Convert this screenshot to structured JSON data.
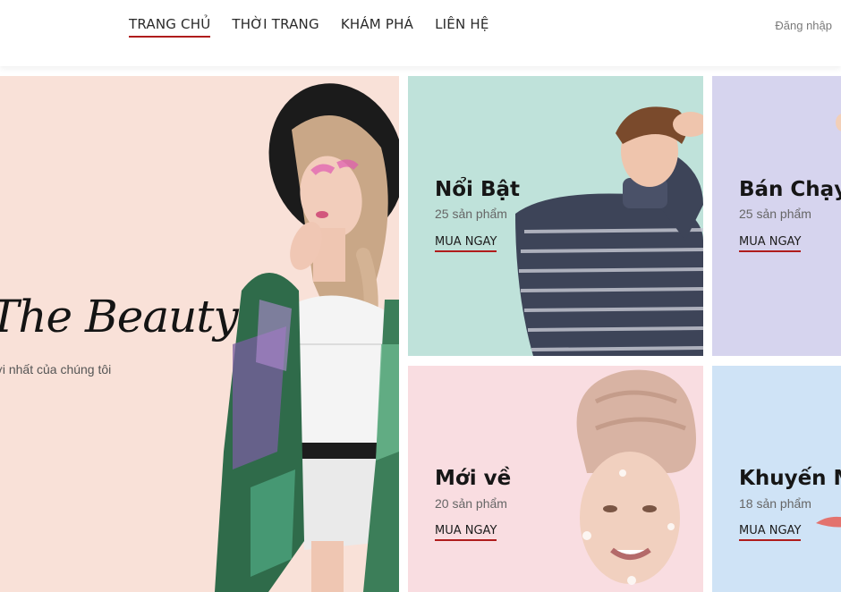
{
  "nav": {
    "items": [
      {
        "label": "TRANG CHỦ",
        "active": true
      },
      {
        "label": "THỜI TRANG",
        "active": false
      },
      {
        "label": "KHÁM PHÁ",
        "active": false
      },
      {
        "label": "LIÊN HỆ",
        "active": false
      }
    ],
    "login_label": "Đăng nhập"
  },
  "hero": {
    "title": "The Beauty",
    "subtitle": "mới nhất của chúng tôi"
  },
  "categories": [
    {
      "title": "Nổi Bật",
      "count": "25 sản phẩm",
      "cta": "MUA NGAY",
      "bg": "#bfe2da"
    },
    {
      "title": "Bán Chạy",
      "count": "25 sản phẩm",
      "cta": "MUA NGAY",
      "bg": "#d6d4ee"
    },
    {
      "title": "Mới về",
      "count": "20 sản phẩm",
      "cta": "MUA NGAY",
      "bg": "#f9dde1"
    },
    {
      "title": "Khuyến M",
      "count": "18 sản phẩm",
      "cta": "MUA NGAY",
      "bg": "#cfe3f6"
    }
  ],
  "colors": {
    "accent": "#b01c1c",
    "hero_bg": "#f9e1d8"
  }
}
